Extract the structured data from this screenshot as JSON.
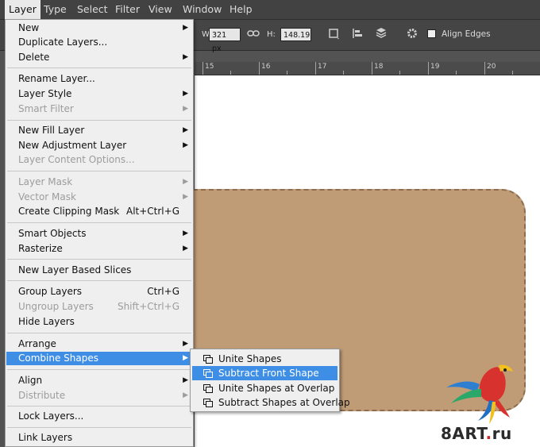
{
  "menubar": {
    "items": [
      "Layer",
      "Type",
      "Select",
      "Filter",
      "View",
      "Window",
      "Help"
    ],
    "active": "Layer"
  },
  "options_bar": {
    "w_label": "W:",
    "w_value": "321 px",
    "link_icon": "link-icon",
    "h_label": "H:",
    "h_value": "148.19",
    "path_ops_icon": "path-operations-icon",
    "path_align_icon": "path-alignment-icon",
    "path_arrange_icon": "path-arrangement-icon",
    "gear_icon": "gear-icon",
    "align_edges_label": "Align Edges",
    "align_edges_checked": false
  },
  "ruler": {
    "labels": [
      "15",
      "16",
      "17",
      "18",
      "19",
      "20"
    ]
  },
  "layer_menu": {
    "items": [
      {
        "label": "New",
        "submenu": true,
        "enabled": true
      },
      {
        "label": "Duplicate Layers...",
        "enabled": true
      },
      {
        "label": "Delete",
        "submenu": true,
        "enabled": true
      },
      {
        "label": "Rename Layer...",
        "enabled": true
      },
      {
        "label": "Layer Style",
        "submenu": true,
        "enabled": true
      },
      {
        "label": "Smart Filter",
        "submenu": true,
        "enabled": false
      },
      {
        "label": "New Fill Layer",
        "submenu": true,
        "enabled": true
      },
      {
        "label": "New Adjustment Layer",
        "submenu": true,
        "enabled": true
      },
      {
        "label": "Layer Content Options...",
        "enabled": false
      },
      {
        "label": "Layer Mask",
        "submenu": true,
        "enabled": false
      },
      {
        "label": "Vector Mask",
        "submenu": true,
        "enabled": false
      },
      {
        "label": "Create Clipping Mask",
        "shortcut": "Alt+Ctrl+G",
        "enabled": true
      },
      {
        "label": "Smart Objects",
        "submenu": true,
        "enabled": true
      },
      {
        "label": "Rasterize",
        "submenu": true,
        "enabled": true
      },
      {
        "label": "New Layer Based Slices",
        "enabled": true
      },
      {
        "label": "Group Layers",
        "shortcut": "Ctrl+G",
        "enabled": true
      },
      {
        "label": "Ungroup Layers",
        "shortcut": "Shift+Ctrl+G",
        "enabled": false
      },
      {
        "label": "Hide Layers",
        "enabled": true
      },
      {
        "label": "Arrange",
        "submenu": true,
        "enabled": true
      },
      {
        "label": "Combine Shapes",
        "submenu": true,
        "enabled": true,
        "highlighted": true
      },
      {
        "label": "Align",
        "submenu": true,
        "enabled": true
      },
      {
        "label": "Distribute",
        "submenu": true,
        "enabled": false
      },
      {
        "label": "Lock Layers...",
        "enabled": true
      },
      {
        "label": "Link Layers",
        "enabled": true
      }
    ]
  },
  "combine_shapes_submenu": {
    "items": [
      {
        "label": "Unite Shapes",
        "icon": "unite-shapes-icon",
        "highlighted": false
      },
      {
        "label": "Subtract Front Shape",
        "icon": "subtract-front-shape-icon",
        "highlighted": true
      },
      {
        "label": "Unite Shapes at Overlap",
        "icon": "intersect-shapes-icon",
        "highlighted": false
      },
      {
        "label": "Subtract Shapes at Overlap",
        "icon": "exclude-overlap-icon",
        "highlighted": false
      }
    ]
  },
  "canvas": {
    "shape_fill": "#bf9b76",
    "background": "#ffffff"
  },
  "watermark": {
    "text_a": "8ART",
    "dot": ".",
    "text_b": "ru"
  },
  "colors": {
    "menu_highlight": "#3e8ee6",
    "menubar_bg": "#424242",
    "menu_bg": "#efefef"
  }
}
